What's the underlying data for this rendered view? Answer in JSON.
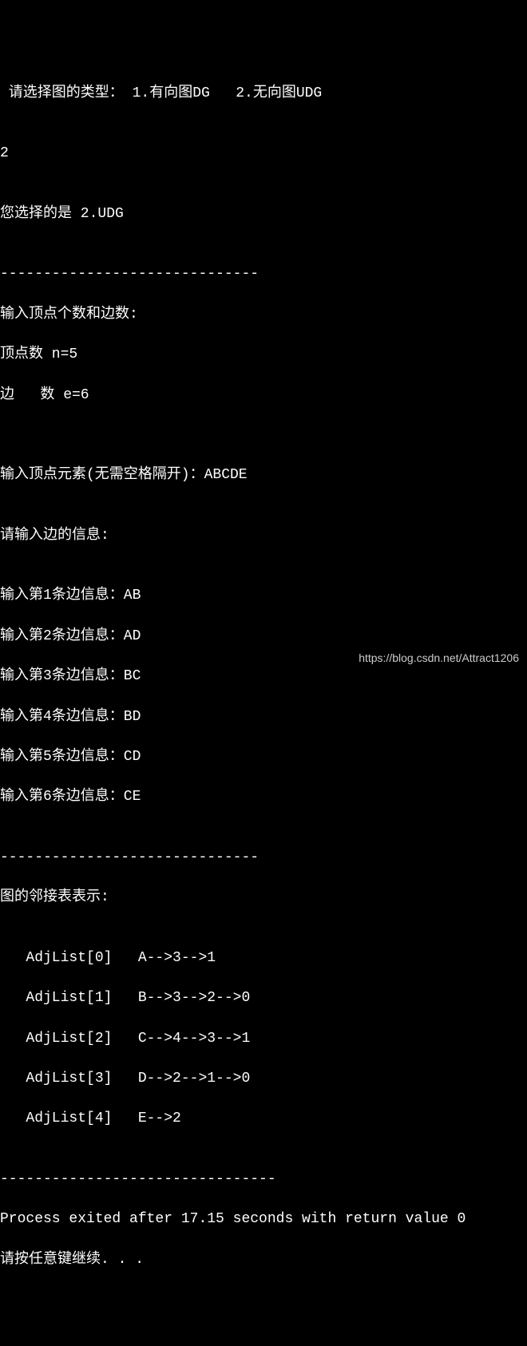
{
  "lines": {
    "l0": " 请选择图的类型： 1.有向图DG   2.无向图UDG",
    "l1": "",
    "l2": "2",
    "l3": "",
    "l4": "您选择的是 2.UDG",
    "l5": "",
    "l6": "------------------------------",
    "l7": "输入顶点个数和边数:",
    "l8": "顶点数 n=5",
    "l9": "边   数 e=6",
    "l10": "",
    "l11": "",
    "l12": "输入顶点元素(无需空格隔开)：ABCDE",
    "l13": "",
    "l14": "请输入边的信息:",
    "l15": "",
    "l16": "输入第1条边信息：AB",
    "l17": "输入第2条边信息：AD",
    "l18": "输入第3条边信息：BC",
    "l19": "输入第4条边信息：BD",
    "l20": "输入第5条边信息：CD",
    "l21": "输入第6条边信息：CE",
    "l22": "",
    "l23": "------------------------------",
    "l24": "图的邻接表表示:",
    "l25": "",
    "l26": "   AdjList[0]   A-->3-->1",
    "l27": "   AdjList[1]   B-->3-->2-->0",
    "l28": "   AdjList[2]   C-->4-->3-->1",
    "l29": "   AdjList[3]   D-->2-->1-->0",
    "l30": "   AdjList[4]   E-->2",
    "l31": "",
    "l32": "--------------------------------",
    "l33": "Process exited after 17.15 seconds with return value 0",
    "l34": "请按任意键继续. . ."
  },
  "watermark": "https://blog.csdn.net/Attract1206"
}
